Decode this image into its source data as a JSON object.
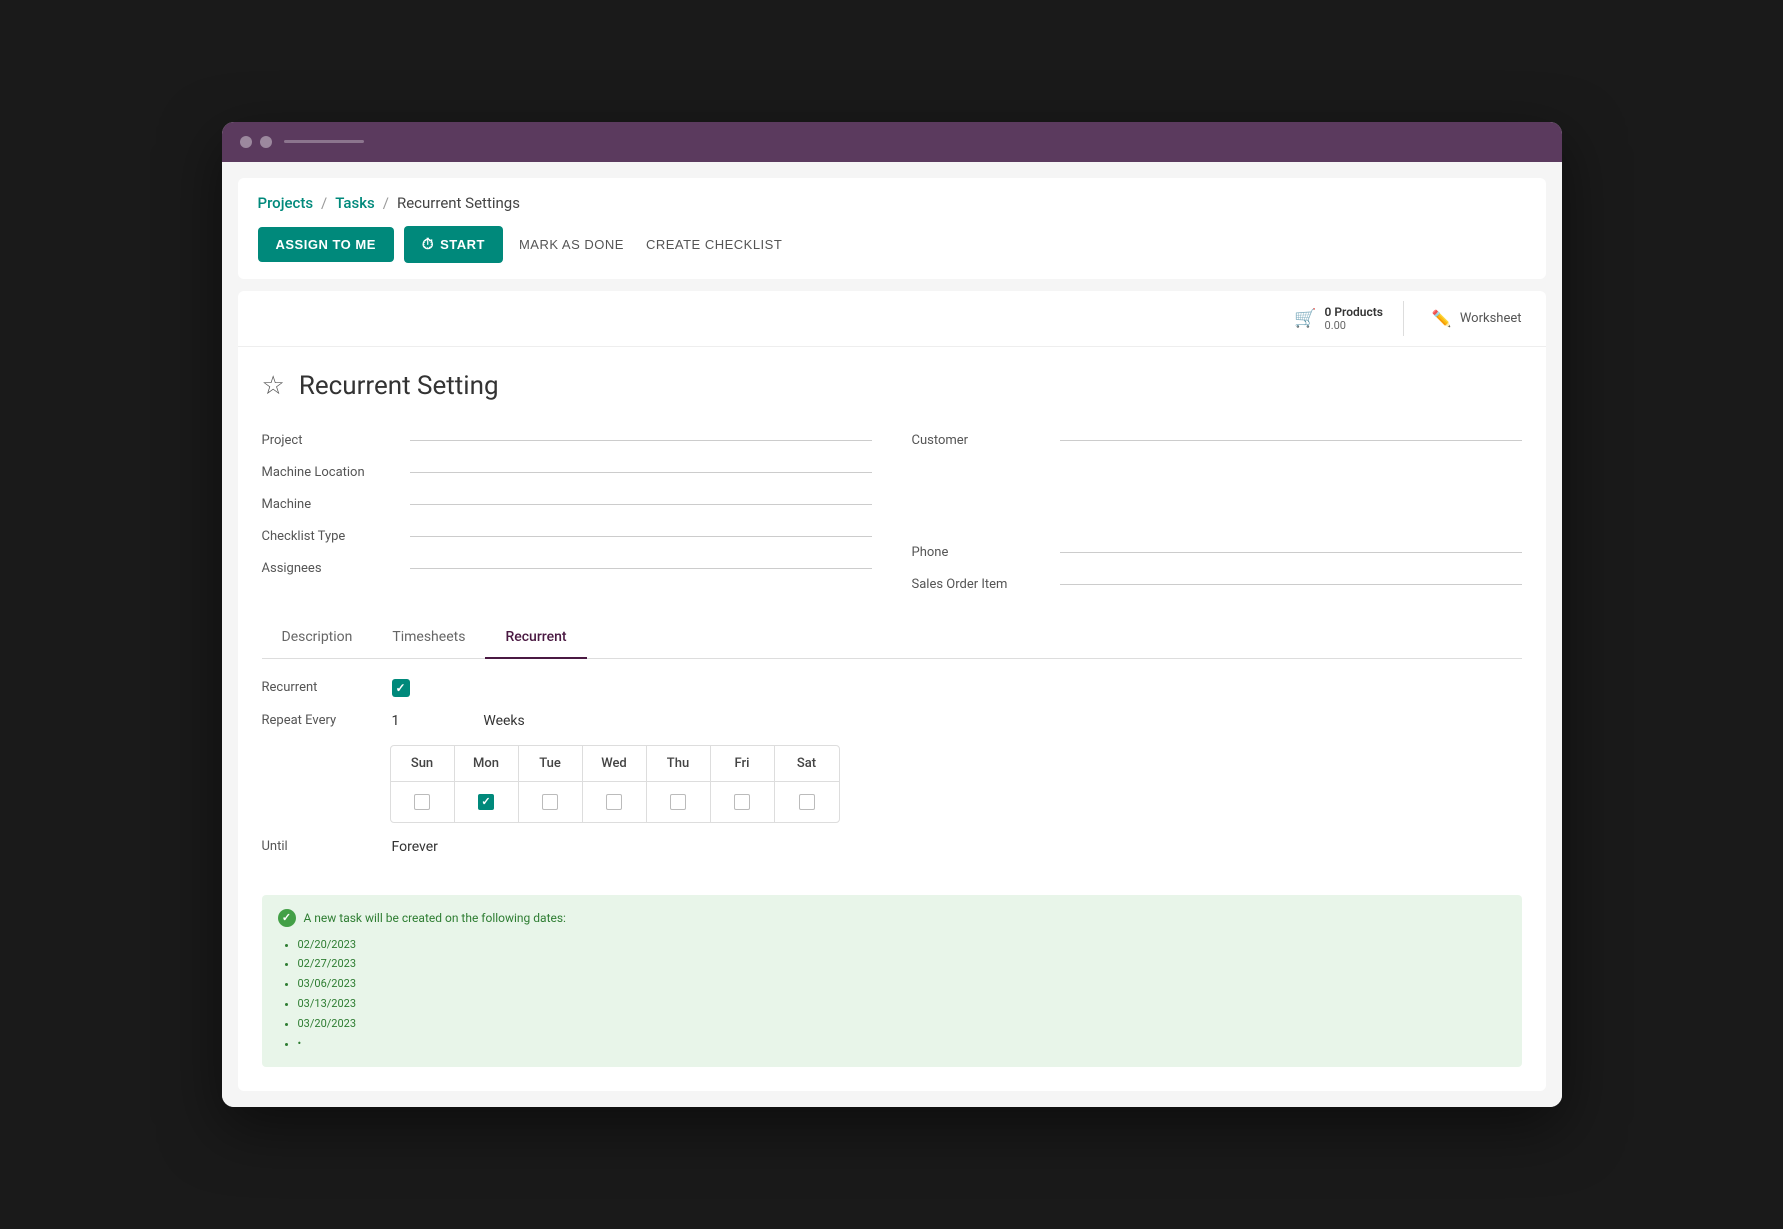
{
  "window": {
    "title": "Projects / Tasks / Recurrent Settings"
  },
  "titlebar": {
    "dots": [
      "dot1",
      "dot2"
    ]
  },
  "breadcrumb": {
    "projects_label": "Projects",
    "sep1": "/",
    "tasks_label": "Tasks",
    "sep2": "/",
    "current_label": "Recurrent Settings"
  },
  "toolbar": {
    "assign_to_me": "ASSIGN TO ME",
    "start": "START",
    "mark_as_done": "MARK AS DONE",
    "create_checklist": "CREATE CHECKLIST"
  },
  "form_header": {
    "products_count": "0 Products",
    "products_amount": "0.00",
    "worksheet_label": "Worksheet"
  },
  "form": {
    "title": "Recurrent Setting",
    "star": "☆",
    "fields_left": [
      {
        "label": "Project",
        "value": ""
      },
      {
        "label": "Machine Location",
        "value": ""
      },
      {
        "label": "Machine",
        "value": ""
      },
      {
        "label": "Checklist Type",
        "value": ""
      },
      {
        "label": "Assignees",
        "value": ""
      }
    ],
    "fields_right": [
      {
        "label": "Customer",
        "value": ""
      },
      {
        "label": "Phone",
        "value": ""
      },
      {
        "label": "Sales Order Item",
        "value": ""
      }
    ]
  },
  "tabs": [
    {
      "id": "description",
      "label": "Description",
      "active": false
    },
    {
      "id": "timesheets",
      "label": "Timesheets",
      "active": false
    },
    {
      "id": "recurrent",
      "label": "Recurrent",
      "active": true
    }
  ],
  "recurrent": {
    "recurrent_label": "Recurrent",
    "recurrent_checked": true,
    "repeat_every_label": "Repeat Every",
    "repeat_value": "1",
    "repeat_unit": "Weeks",
    "days": [
      {
        "label": "Sun",
        "checked": false
      },
      {
        "label": "Mon",
        "checked": true
      },
      {
        "label": "Tue",
        "checked": false
      },
      {
        "label": "Wed",
        "checked": false
      },
      {
        "label": "Thu",
        "checked": false
      },
      {
        "label": "Fri",
        "checked": false
      },
      {
        "label": "Sat",
        "checked": false
      }
    ],
    "until_label": "Until",
    "until_value": "Forever",
    "info_message": "A new task will be created on the following dates:",
    "dates": [
      "02/20/2023",
      "02/27/2023",
      "03/06/2023",
      "03/13/2023",
      "03/20/2023",
      ""
    ]
  },
  "colors": {
    "teal": "#00897b",
    "purple_dark": "#4a1942",
    "titlebar": "#5b3a5e",
    "green_text": "#2e7d32",
    "green_bg": "#e8f5e9"
  }
}
